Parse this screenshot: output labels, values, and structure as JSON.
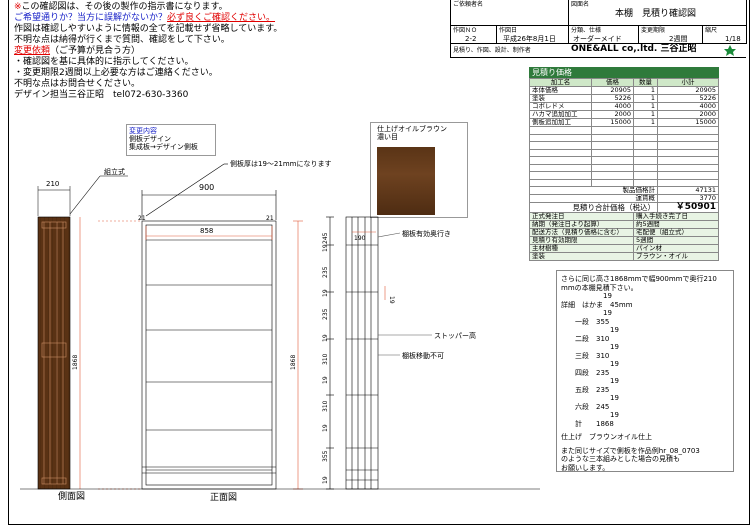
{
  "notes": {
    "line1_mark": "※",
    "line1": "この確認図は、その後の製作の指示書になります。",
    "line2": "ご希望通りか？当方に誤解がないか？",
    "line2_emph": "必ず良くご確認ください。",
    "line3": "作図は確認しやすいように情報の全てを記載せず省略しています。",
    "line4": "不明な点は納得が行くまで質問、確認をして下さい。",
    "line5_title": "変更依頼",
    "line5_rest": "（ご予算が見合う方）",
    "line6": "・確認図を基に具体的に指示してください。",
    "line7": "・変更期限2週間以上必要な方はご連絡ください。",
    "line8": "不明な点はお問合せください。",
    "line9": "デザイン担当三谷正昭　tel072-630-3360"
  },
  "title_block": {
    "customer_label": "ご依頼者名",
    "drawing_label": "図面名",
    "drawing_name": "本棚　見積り確認図",
    "no_label": "作図ＮＯ",
    "no_value": "2-2",
    "date_label": "作図日",
    "date_value": "平成26年8月1日",
    "type_label": "分類、仕様",
    "type_value": "オーダーメイド",
    "period_label": "変更期限",
    "period_value": "2週間",
    "scale_label": "縮尺",
    "scale_value": "1/18",
    "footer_left": "見積り、作図、設計、制作者",
    "footer_right": "ONE&ALL co,.ltd. 三谷正昭"
  },
  "estimate": {
    "title": "見積り価格",
    "headers": [
      "加工名",
      "価格",
      "数量",
      "小計"
    ],
    "rows": [
      [
        "本体価格",
        "20905",
        "1",
        "20905"
      ],
      [
        "塗装",
        "5226",
        "1",
        "5226"
      ],
      [
        "コボレドメ",
        "4000",
        "1",
        "4000"
      ],
      [
        "ハカマ追加加工",
        "2000",
        "1",
        "2000"
      ],
      [
        "側板追加加工",
        "15000",
        "1",
        "15000"
      ]
    ],
    "product_total_label": "製品価格計",
    "product_total": "47131",
    "shipping_label": "運賃概",
    "shipping": "3770",
    "grand_label": "見積り合計価格（税込）",
    "grand_total": "￥50901",
    "terms": [
      [
        "正式発注日",
        "購入手続き完了日"
      ],
      [
        "納期（発注日より起算）",
        "約5週間"
      ],
      [
        "配送方法（見積り価格に含む）",
        "宅配便（組立式）"
      ],
      [
        "見積り有効期限",
        "5週間"
      ],
      [
        "主材樹種",
        "パイン材"
      ],
      [
        "塗装",
        "ブラウン・オイル"
      ]
    ]
  },
  "change_box": {
    "title": "変更内容",
    "line1": "側板デザイン",
    "line2": "集成板→デザイン側板"
  },
  "finish_box": {
    "line1": "仕上げオイルブラウン",
    "line2": "濃い目"
  },
  "drawing": {
    "side_width": "210",
    "assembly_note": "組立式",
    "side_thickness_note": "側板厚は19〜21mmになります",
    "front_width": "900",
    "inner_width": "858",
    "left_21": "21",
    "right_21": "21",
    "height": "1868",
    "right_height": "1868",
    "side_label": "側面図",
    "front_label": "正面図",
    "shelf_depth_note": "棚板有効奥行き",
    "stopper_note": "ストッパー高",
    "fixed_shelf_note": "棚板移動不可",
    "depth_190": "190",
    "dim_19": "19",
    "vertical_dims": [
      "245",
      "19",
      "235",
      "19",
      "235",
      "19",
      "310",
      "19",
      "310",
      "19",
      "355",
      "19"
    ]
  },
  "right_note": {
    "lines": [
      "さらに同じ高さ1868mmで幅900mmで奥行210",
      "mmの本棚見積下さい。",
      "　　　　　　19",
      "詳細　はかま　45mm",
      "　　　　　　19",
      "　　一段　355",
      "　　　　　　　19",
      "　　二段　310",
      "　　　　　　　19",
      "　　三段　310",
      "　　　　　　　19",
      "　　四段　235",
      "　　　　　　　19",
      "　　五段　235",
      "　　　　　　　19",
      "　　六段　245",
      "　　　　　　　19",
      "　　計　　1868",
      "",
      "仕上げ　ブラウンオイル仕上",
      "",
      "また同じサイズで側板を作品例hr_08_0703",
      "のような三本組みとした場合の見積も",
      "お願いします。"
    ]
  }
}
